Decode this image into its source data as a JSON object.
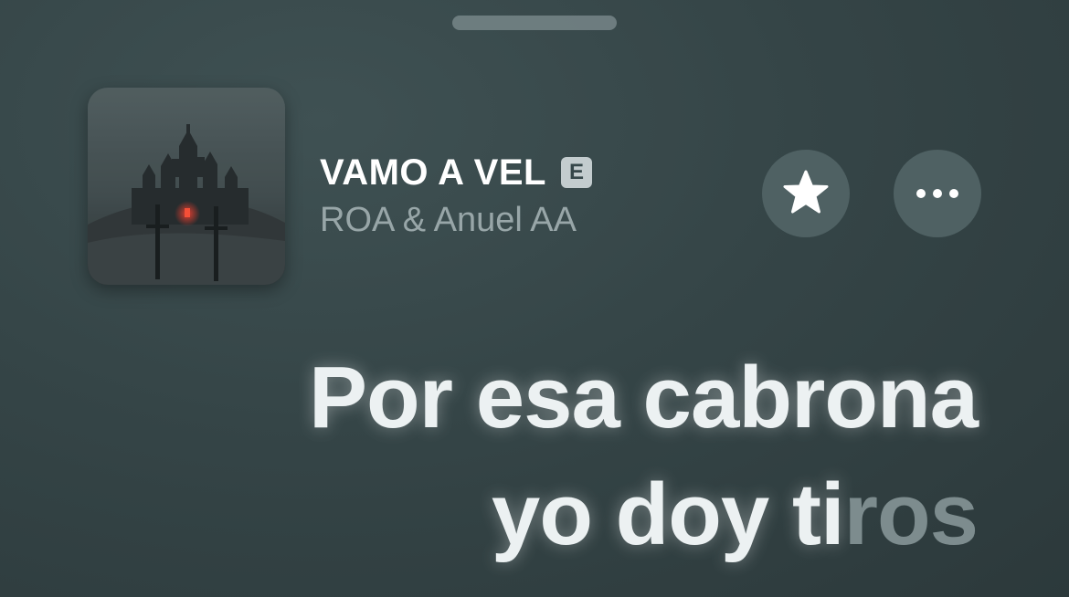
{
  "now_playing": {
    "title": "VAMO A VEL",
    "explicit_badge": "E",
    "artist": "ROA & Anuel AA",
    "artwork_icon": "album-artwork-castle"
  },
  "actions": {
    "favorite_icon": "star-icon",
    "more_icon": "ellipsis-icon"
  },
  "lyrics": {
    "line1": "Por esa cabrona",
    "line2_sung": "yo doy ti",
    "line2_unsung": "ros"
  },
  "colors": {
    "background": "#354547",
    "lyric_active": "#ecf1f2",
    "lyric_inactive": "#7d8c8e",
    "artist_text": "#98a6a8"
  }
}
